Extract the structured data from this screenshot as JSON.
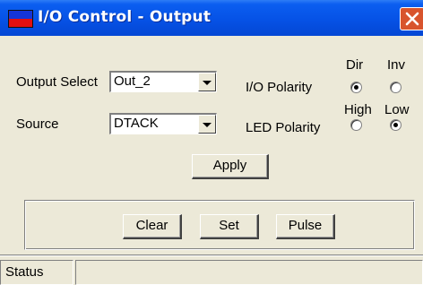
{
  "window": {
    "title": "I/O Control - Output",
    "close_symbol": "×"
  },
  "output_select": {
    "label": "Output Select",
    "value": "Out_2"
  },
  "source": {
    "label": "Source",
    "value": "DTACK"
  },
  "io_polarity": {
    "label": "I/O Polarity",
    "options": [
      "Dir",
      "Inv"
    ],
    "selected": "Dir"
  },
  "led_polarity": {
    "label": "LED Polarity",
    "options": [
      "High",
      "Low"
    ],
    "selected": "Low"
  },
  "buttons": {
    "apply": "Apply",
    "clear": "Clear",
    "set": "Set",
    "pulse": "Pulse"
  },
  "status_bar": {
    "label": "Status",
    "value": ""
  },
  "icons": {
    "app": "app-icon",
    "close": "close-icon",
    "dropdown": "chevron-down-icon"
  },
  "colors": {
    "titlebar": "#0652e6",
    "window_bg": "#ece9d8",
    "close_button": "#d8542d"
  }
}
